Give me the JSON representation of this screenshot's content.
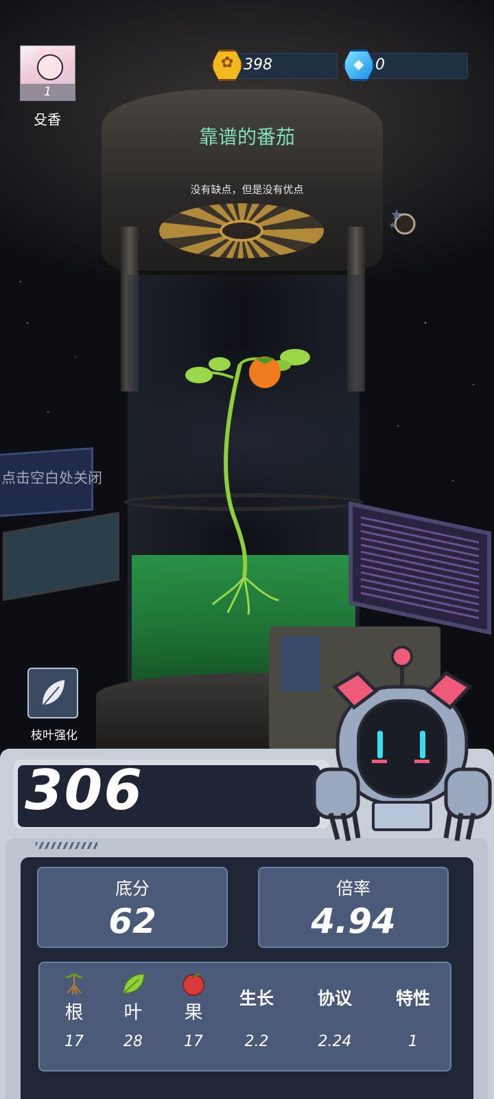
{
  "player": {
    "level": "1",
    "name": "殳香"
  },
  "currency": {
    "coins": "398",
    "gems": "0"
  },
  "plant": {
    "title": "靠谱的番茄",
    "description": "没有缺点，但是没有优点"
  },
  "hint": "点击空白处关闭",
  "skill": {
    "label": "枝叶强化",
    "icon": "leaf-icon"
  },
  "score": {
    "total": "306"
  },
  "metrics": {
    "base": {
      "label": "底分",
      "value": "62"
    },
    "multiplier": {
      "label": "倍率",
      "value": "4.94"
    }
  },
  "breakdown": [
    {
      "name": "根",
      "value": "17",
      "icon": "root-icon"
    },
    {
      "name": "叶",
      "value": "28",
      "icon": "leaf-icon"
    },
    {
      "name": "果",
      "value": "17",
      "icon": "fruit-icon"
    },
    {
      "name": "生长",
      "value": "2.2"
    },
    {
      "name": "协议",
      "value": "2.24"
    },
    {
      "name": "特性",
      "value": "1"
    }
  ],
  "colors": {
    "title": "#7fe0b8",
    "panel": "#1f2636",
    "card": "#4a5a78",
    "coin": "#f2b81d",
    "gem": "#1a8fe8",
    "liquid": "#2b9e4a"
  }
}
